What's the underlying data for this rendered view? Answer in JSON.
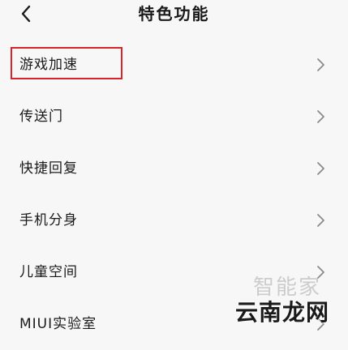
{
  "header": {
    "title": "特色功能",
    "back_icon": "chevron-left-icon"
  },
  "list": {
    "items": [
      {
        "label": "游戏加速",
        "highlighted": true
      },
      {
        "label": "传送门"
      },
      {
        "label": "快捷回复"
      },
      {
        "label": "手机分身"
      },
      {
        "label": "儿童空间"
      },
      {
        "label": "MIUI实验室"
      }
    ],
    "chevron_icon": "chevron-right-icon"
  },
  "watermark": {
    "top_text": "智能家",
    "bottom_text": "云南龙网"
  },
  "colors": {
    "background": "#f7f7f7",
    "text": "#1a1a1a",
    "chevron": "#8a8a8a",
    "highlight": "#d8232a"
  }
}
